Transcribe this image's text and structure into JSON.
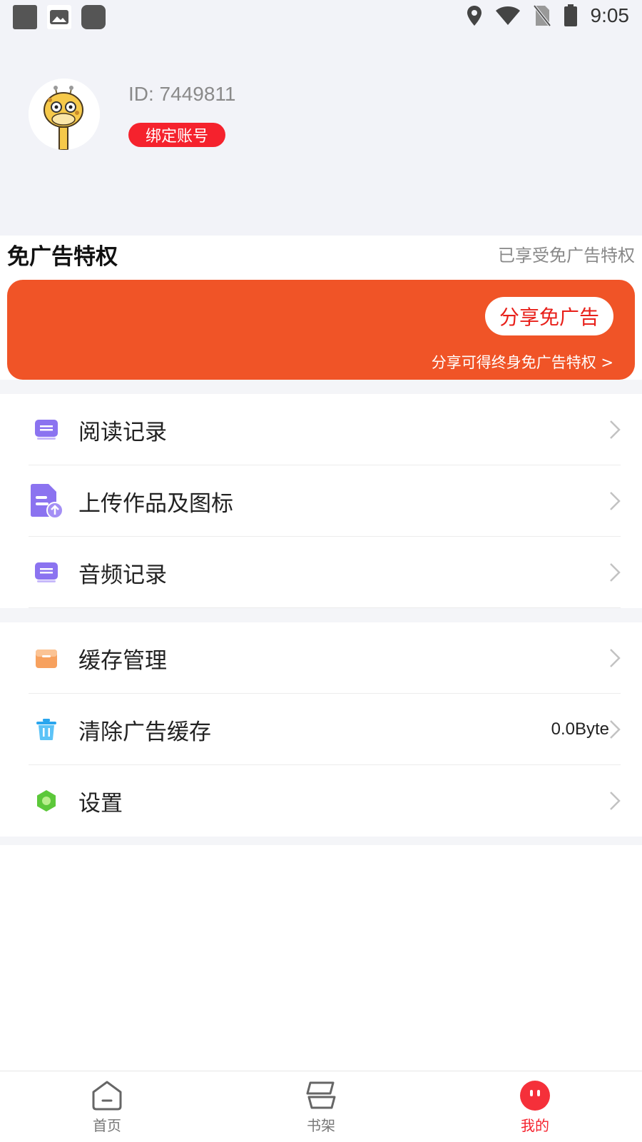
{
  "status_bar": {
    "time": "9:05"
  },
  "profile": {
    "user_id": "ID: 7449811",
    "bind_label": "绑定账号"
  },
  "ad_privilege": {
    "title": "免广告特权",
    "status": "已享受免广告特权",
    "share_button": "分享免广告",
    "share_note": "分享可得终身免广告特权 >"
  },
  "menu_group_1": [
    {
      "label": "阅读记录",
      "icon": "reading-history-icon"
    },
    {
      "label": "上传作品及图标",
      "icon": "upload-document-icon"
    },
    {
      "label": "音频记录",
      "icon": "audio-history-icon"
    }
  ],
  "menu_group_2": [
    {
      "label": "缓存管理",
      "icon": "cache-box-icon"
    },
    {
      "label": "清除广告缓存",
      "icon": "trash-icon",
      "value": "0.0Byte"
    },
    {
      "label": "设置",
      "icon": "settings-hexagon-icon"
    }
  ],
  "bottom_nav": [
    {
      "label": "首页",
      "icon": "home-icon"
    },
    {
      "label": "书架",
      "icon": "bookshelf-icon"
    },
    {
      "label": "我的",
      "icon": "profile-face-icon",
      "active": true
    }
  ],
  "colors": {
    "accent_red": "#f5222d",
    "banner_orange": "#f05427",
    "purple_icon": "#8b73f0",
    "background_gray": "#f2f3f8"
  }
}
